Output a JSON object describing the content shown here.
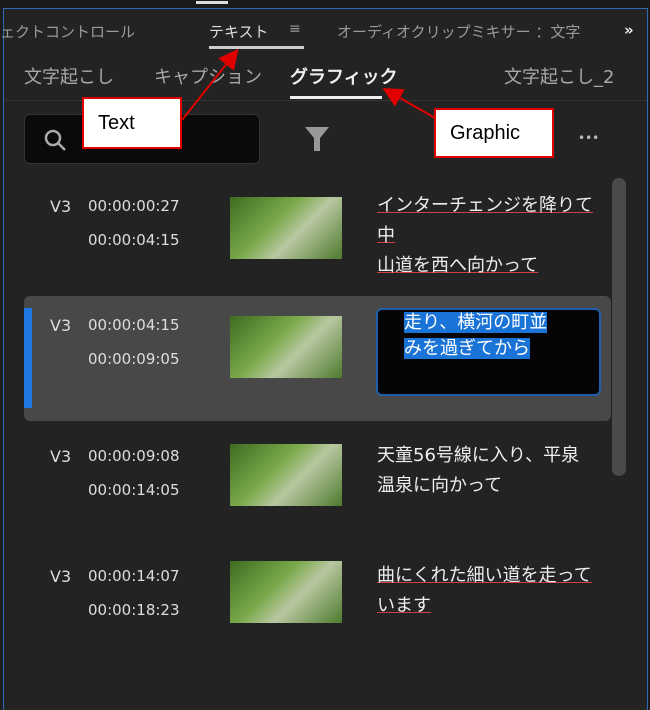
{
  "panel_tabs": [
    {
      "label": "ェクトコントロール"
    },
    {
      "label": "テキスト",
      "active": true
    },
    {
      "label": "オーディオクリップミキサー ：文字"
    }
  ],
  "sub_tabs": [
    {
      "label": "文字起こし"
    },
    {
      "label": "キャプション"
    },
    {
      "label": "グラフィック",
      "active": true
    },
    {
      "label": "文字起こし_2"
    }
  ],
  "overflow_icon": "»",
  "menu_icon": "≡",
  "more_icon": "•••",
  "callouts": {
    "text": "Text",
    "graphic": "Graphic"
  },
  "rows": [
    {
      "track": "V3",
      "start": "00:00:00:27",
      "end": "00:00:04:15",
      "lines": [
        "インターチェンジを降りて中",
        "山道を西へ向かって"
      ]
    },
    {
      "track": "V3",
      "start": "00:00:04:15",
      "end": "00:00:09:05",
      "lines": [
        "走り、横河の町並",
        "みを過ぎてから"
      ],
      "selected": true
    },
    {
      "track": "V3",
      "start": "00:00:09:08",
      "end": "00:00:14:05",
      "lines": [
        "天童56号線に入り、平泉",
        "温泉に向かって"
      ]
    },
    {
      "track": "V3",
      "start": "00:00:14:07",
      "end": "00:00:18:23",
      "lines": [
        "曲にくれた細い道を走って",
        "います"
      ]
    }
  ],
  "colors": {
    "accent": "#1e7ae0",
    "callout_border": "#e00000"
  }
}
